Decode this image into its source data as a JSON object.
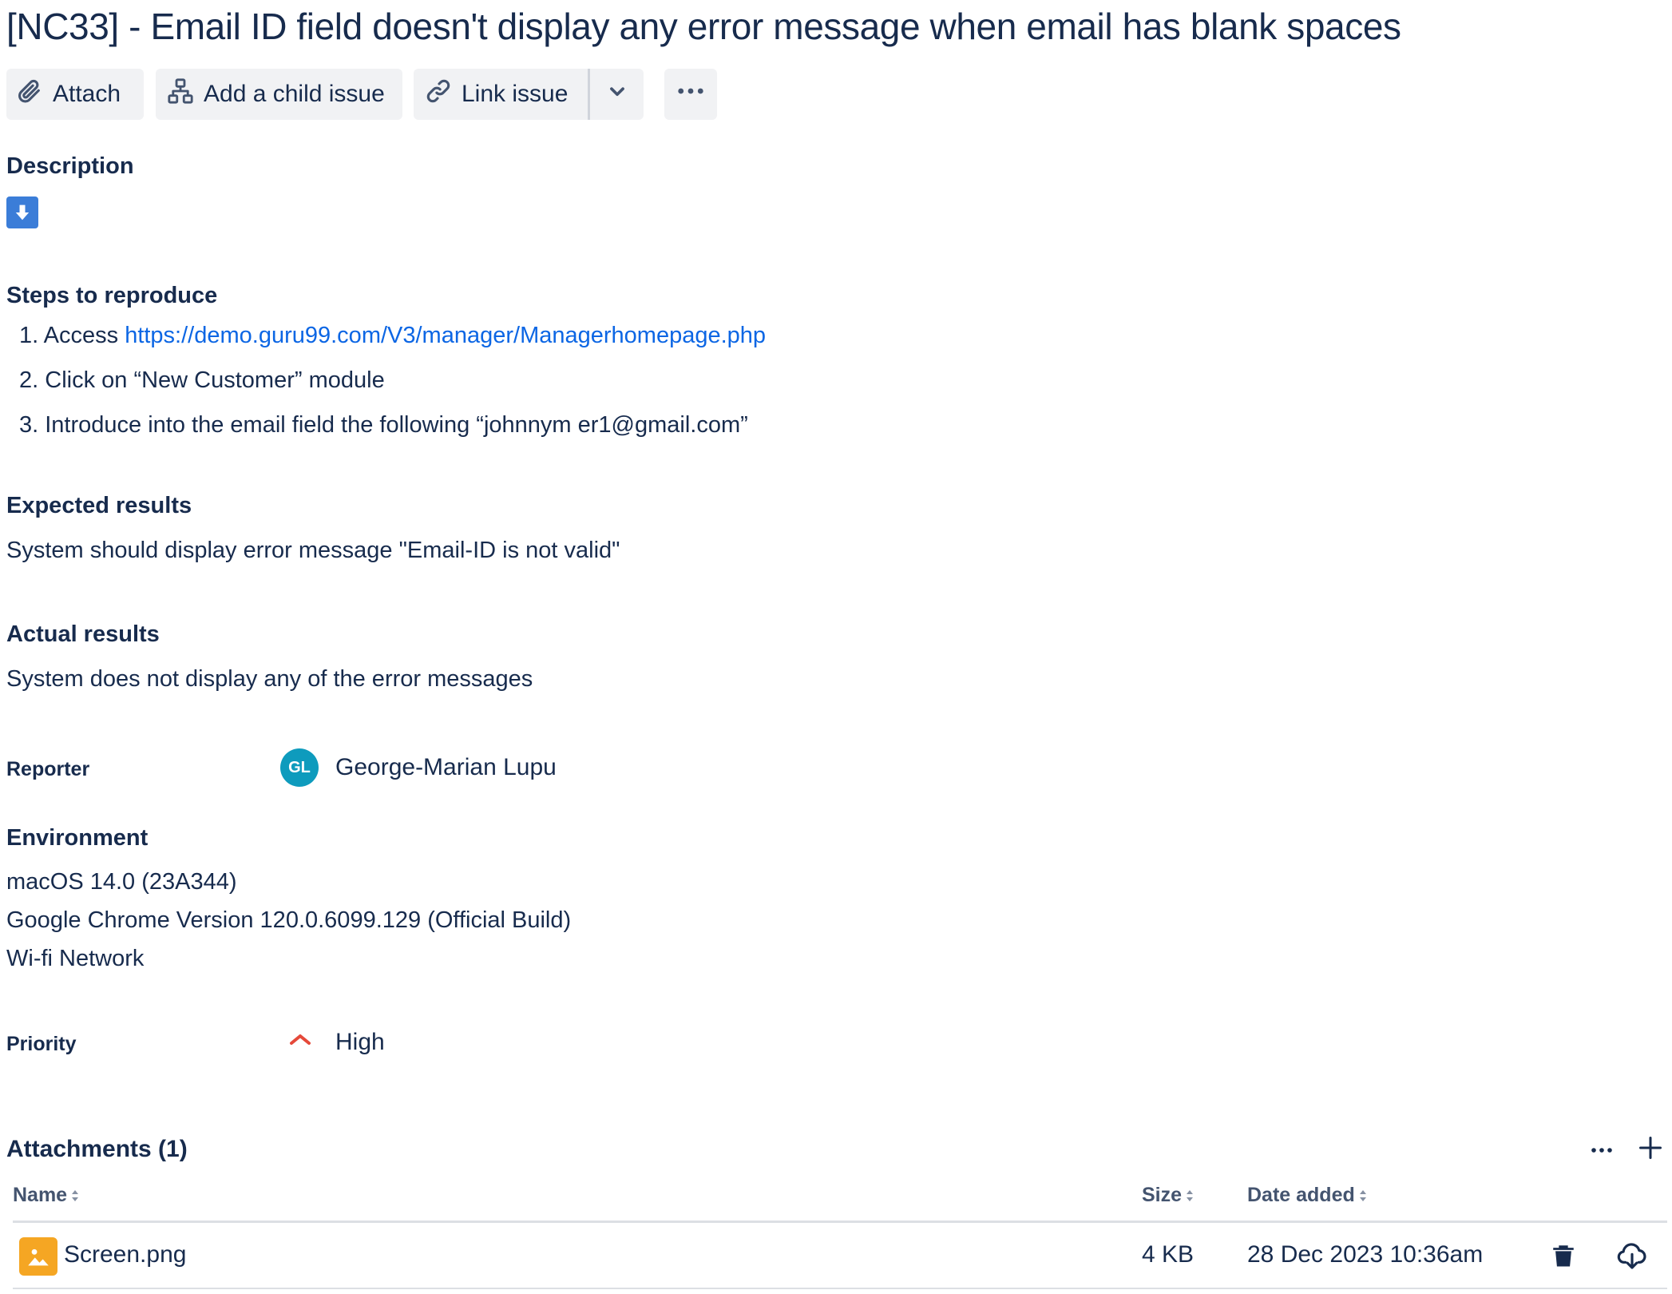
{
  "issue": {
    "title": "[NC33] - Email ID field doesn't display any error message when email has blank spaces"
  },
  "toolbar": {
    "attach_label": "Attach",
    "child_label": "Add a child issue",
    "link_label": "Link issue"
  },
  "description": {
    "heading": "Description",
    "steps_heading": "Steps to reproduce",
    "steps": [
      {
        "num": "1.",
        "prefix": "Access ",
        "link": "https://demo.guru99.com/V3/manager/Managerhomepage.php"
      },
      {
        "num": "2.",
        "text": "Click on “New Customer” module"
      },
      {
        "num": "3.",
        "text": "Introduce into the email field the following “johnnym er1@gmail.com”"
      }
    ],
    "expected_heading": "Expected results",
    "expected_text": "System should display error message \"Email-ID is not valid\"",
    "actual_heading": "Actual results",
    "actual_text": "System does not display any of the error messages"
  },
  "reporter": {
    "label": "Reporter",
    "initials": "GL",
    "name": "George-Marian Lupu"
  },
  "environment": {
    "heading": "Environment",
    "lines": [
      "macOS 14.0 (23A344)",
      "Google Chrome Version 120.0.6099.129 (Official Build)",
      "Wi-fi Network"
    ]
  },
  "priority": {
    "label": "Priority",
    "value": "High",
    "color": "#e5493a"
  },
  "attachments": {
    "heading": "Attachments (1)",
    "columns": {
      "name": "Name",
      "size": "Size",
      "date": "Date added"
    },
    "rows": [
      {
        "name": "Screen.png",
        "size": "4 KB",
        "date": "28 Dec 2023 10:36am"
      }
    ]
  },
  "colors": {
    "text": "#172b4d",
    "link": "#0c66e4",
    "button_bg": "#f1f2f4",
    "avatar_bg": "#0e9bbd",
    "file_icon_bg": "#f5a623"
  },
  "icons": [
    "paperclip-icon",
    "hierarchy-icon",
    "link-icon",
    "chevron-down-icon",
    "more-icon",
    "download-arrow-icon",
    "priority-high-icon",
    "plus-icon",
    "sort-icon",
    "image-file-icon",
    "trash-icon",
    "cloud-download-icon"
  ]
}
